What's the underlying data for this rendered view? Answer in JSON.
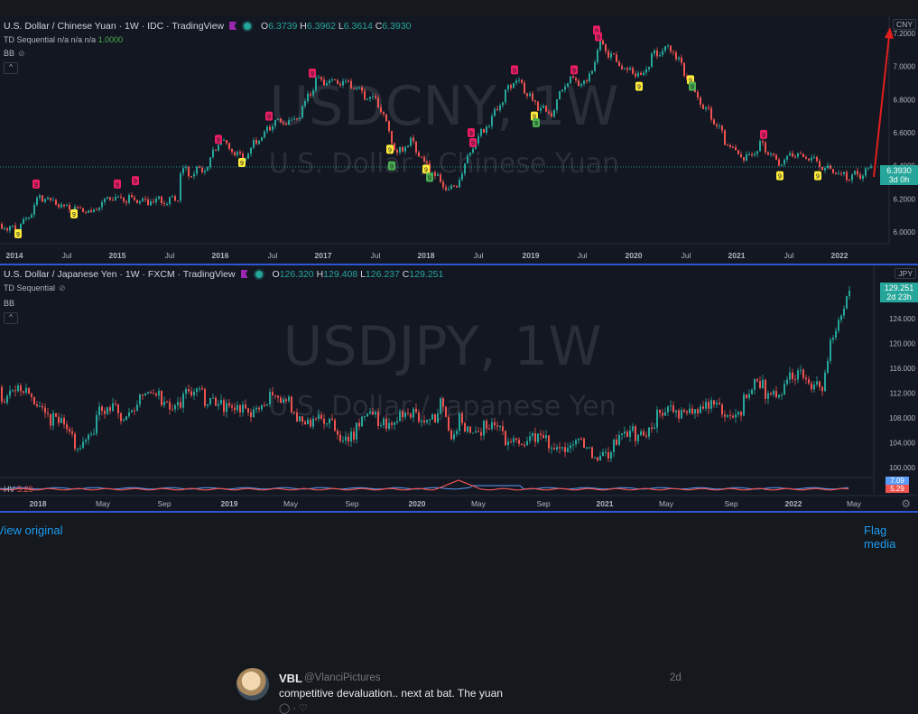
{
  "cny": {
    "title": "U.S. Dollar / Chinese Yuan · 1W · IDC · TradingView",
    "open_label": "O",
    "open": "6.3739",
    "high_label": "H",
    "high": "6.3962",
    "low_label": "L",
    "low": "6.3614",
    "close_label": "C",
    "close": "6.3930",
    "indicator_name": "TD Sequential",
    "indicator_values": "n/a n/a n/a",
    "indicator_last": "1.0000",
    "bb_label": "BB",
    "watermark_symbol": "USDCNY, 1W",
    "watermark_name": "U.S. Dollar / Chinese Yuan",
    "currency": "CNY",
    "last_price": "6.3930",
    "countdown": "3d 0h",
    "y_ticks": [
      "7.2000",
      "7.0000",
      "6.8000",
      "6.6000",
      "6.4000",
      "6.2000",
      "6.0000"
    ],
    "x_ticks": [
      "2014",
      "Jul",
      "2015",
      "Jul",
      "2016",
      "Jul",
      "2017",
      "Jul",
      "2018",
      "Jul",
      "2019",
      "Jul",
      "2020",
      "Jul",
      "2021",
      "Jul",
      "2022"
    ]
  },
  "jpy": {
    "title": "U.S. Dollar / Japanese Yen · 1W · FXCM · TradingView",
    "open_label": "O",
    "open": "126.320",
    "high_label": "H",
    "high": "129.408",
    "low_label": "L",
    "low": "126.237",
    "close_label": "C",
    "close": "129.251",
    "indicator_name": "TD Sequential",
    "bb_label": "BB",
    "watermark_symbol": "USDJPY, 1W",
    "watermark_name": "U.S. Dollar / Japanese Yen",
    "currency": "JPY",
    "last_price": "129.251",
    "countdown": "2d 23h",
    "hv_label": "HV",
    "hv_value": "5.29",
    "hv_value2": "7.09",
    "hv_value3": "5.29",
    "y_ticks": [
      "124.000",
      "120.000",
      "116.000",
      "112.000",
      "108.000",
      "104.000",
      "100.000"
    ],
    "x_ticks": [
      "2018",
      "May",
      "Sep",
      "2019",
      "May",
      "Sep",
      "2020",
      "May",
      "Sep",
      "2021",
      "May",
      "Sep",
      "2022",
      "May"
    ]
  },
  "links": {
    "view_original": "View original",
    "flag_media": "Flag media"
  },
  "tweet": {
    "name": "VBL",
    "handle": "@VlanciPictures",
    "time": "2d",
    "text": "competitive devaluation.. next at bat. The yuan"
  },
  "colors": {
    "up": "#26a69a",
    "down": "#ef5350",
    "background": "#131722",
    "accent": "#2d55d4",
    "arrow": "#e01e1e"
  },
  "icons": [
    "eye-slash-icon",
    "chevron-up-icon",
    "flag-icon",
    "live-dot-icon",
    "gear-icon"
  ]
}
